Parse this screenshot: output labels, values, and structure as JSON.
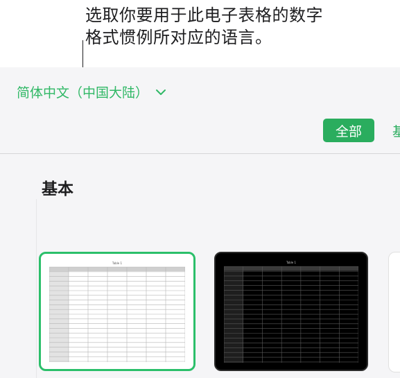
{
  "annotation": {
    "line1": "选取你要用于此电子表格的数字",
    "line2": "格式惯例所对应的语言。"
  },
  "language_selector": {
    "value": "简体中文（中国大陆）",
    "icon": "chevron-down-icon"
  },
  "filter_tabs": {
    "active": "全部",
    "next": "基"
  },
  "section": {
    "title": "基本"
  },
  "templates": [
    {
      "name": "basic-blank",
      "table_title": "Table 1"
    },
    {
      "name": "basic-dark",
      "table_title": "Table 1"
    }
  ],
  "colors": {
    "accent": "#2aad5e",
    "accent_text": "#30b866",
    "selection": "#2bbf6a",
    "panel_bg": "#f5f5f7"
  }
}
